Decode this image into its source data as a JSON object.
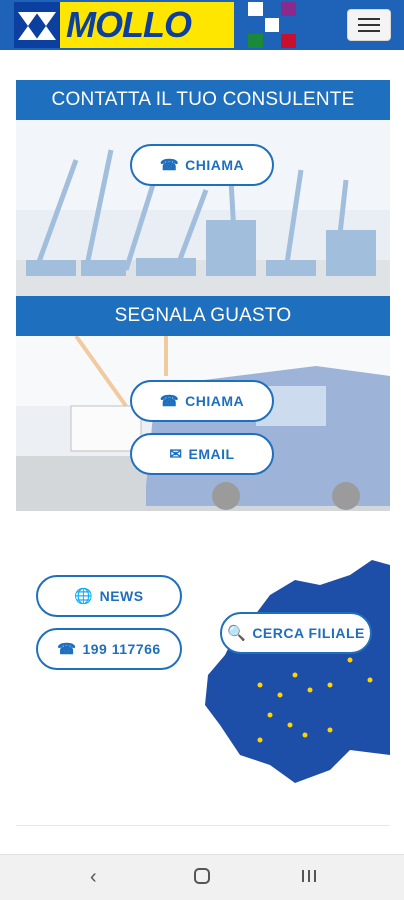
{
  "header": {
    "logo_text": "MOLLO",
    "menu_icon": "hamburger-icon",
    "colors": {
      "bar": "#1f63b8",
      "logo_bg": "#ffe600",
      "logo_fg": "#0b3fa0"
    }
  },
  "consulente": {
    "title": "CONTATTA IL TUO CONSULENTE",
    "call_label": "CHIAMA",
    "call_icon": "phone-icon"
  },
  "guasto": {
    "title": "SEGNALA GUASTO",
    "call_label": "CHIAMA",
    "call_icon": "phone-icon",
    "email_label": "EMAIL",
    "email_icon": "envelope-icon"
  },
  "contacts": {
    "news_label": "NEWS",
    "news_icon": "globe-icon",
    "phone_label": "199 117766",
    "phone_icon": "phone-icon",
    "branch_label": "CERCA FILIALE",
    "branch_icon": "search-icon"
  },
  "navbar": {
    "back_icon": "back-icon",
    "home_icon": "home-icon",
    "recents_icon": "recents-icon"
  },
  "accent_color": "#1f6fbf"
}
